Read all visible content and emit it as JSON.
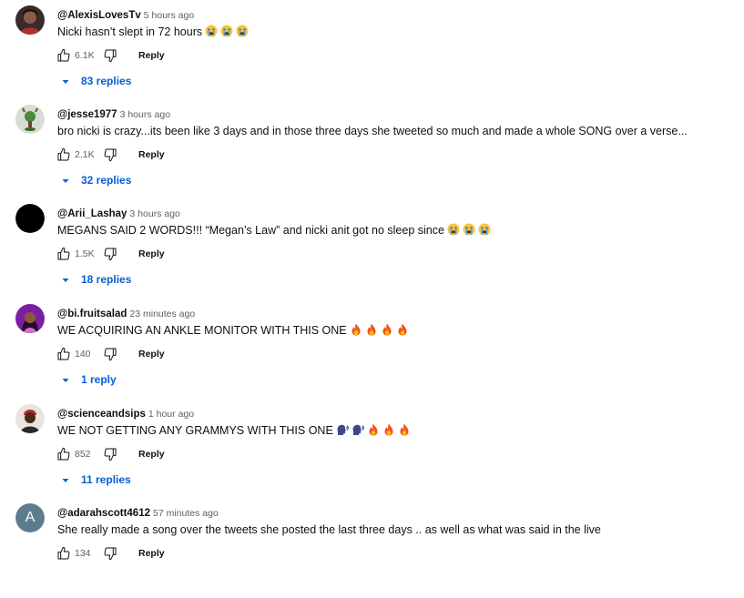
{
  "comments": [
    {
      "author": "@AlexisLovesTv",
      "time": "5 hours ago",
      "text": "Nicki hasn’t slept in 72 hours",
      "emojis": [
        "crying-face",
        "crying-face",
        "crying-face"
      ],
      "likes": "6.1K",
      "reply_label": "Reply",
      "replies": "83 replies",
      "avatar_icon": "avatar-dark-portrait"
    },
    {
      "author": "@jesse1977",
      "time": "3 hours ago",
      "text": "bro nicki is crazy...its been like 3 days and in those three days she tweeted so much and made a whole SONG over a verse...",
      "emojis": [],
      "likes": "2.1K",
      "reply_label": "Reply",
      "replies": "32 replies",
      "avatar_icon": "avatar-green-plant"
    },
    {
      "author": "@Arii_Lashay",
      "time": "3 hours ago",
      "text": "MEGANS SAID 2 WORDS!!! “Megan’s Law” and nicki anit got no sleep since",
      "emojis": [
        "crying-face",
        "crying-face",
        "crying-face"
      ],
      "likes": "1.5K",
      "reply_label": "Reply",
      "replies": "18 replies",
      "avatar_icon": "avatar-black-circle"
    },
    {
      "author": "@bi.fruitsalad",
      "time": "23 minutes ago",
      "text": "WE ACQUIRING AN ANKLE MONITOR WITH THIS ONE",
      "emojis": [
        "fire",
        "fire",
        "fire",
        "fire"
      ],
      "likes": "140",
      "reply_label": "Reply",
      "replies": "1 reply",
      "avatar_icon": "avatar-purple-portrait"
    },
    {
      "author": "@scienceandsips",
      "time": "1 hour ago",
      "text": "WE NOT GETTING ANY GRAMMYS WITH THIS ONE",
      "emojis": [
        "speaking-head",
        "speaking-head",
        "fire",
        "fire",
        "fire"
      ],
      "likes": "852",
      "reply_label": "Reply",
      "replies": "11 replies",
      "avatar_icon": "avatar-red-portrait"
    },
    {
      "author": "@adarahscott4612",
      "time": "57 minutes ago",
      "text": "She really made a song over the tweets she posted the last three days .. as well as what was said in the live",
      "emojis": [],
      "likes": "134",
      "reply_label": "Reply",
      "replies": "",
      "avatar_icon": "avatar-letter",
      "avatar_letter": "A"
    }
  ],
  "colors": {
    "link_blue": "#065fd4",
    "text": "#0f0f0f",
    "secondary_text": "#606060",
    "avatar_letter_bg": "#5f7c8e"
  }
}
